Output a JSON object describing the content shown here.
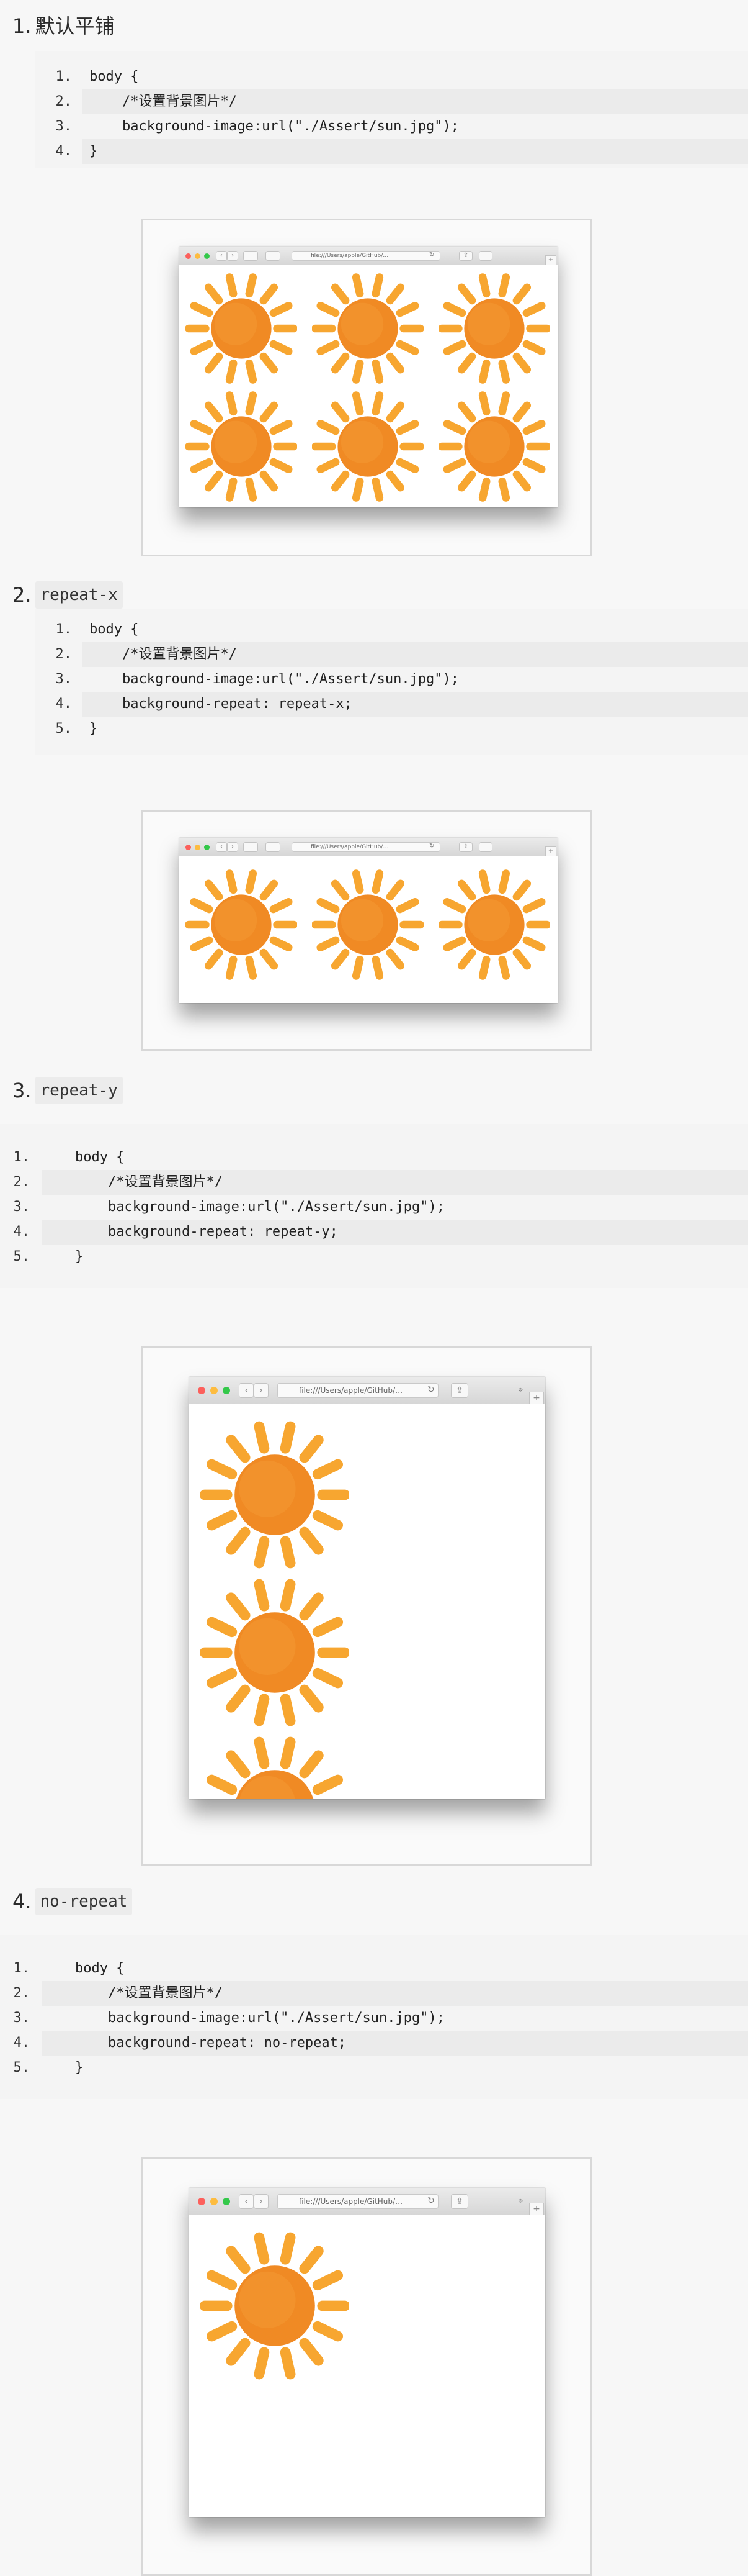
{
  "sections": [
    {
      "number": "1.",
      "title": "默认平铺",
      "lines": [
        {
          "n": "1.",
          "code": "body {"
        },
        {
          "n": "2.",
          "code": "    /*设置背景图片*/"
        },
        {
          "n": "3.",
          "code": "    background-image:url(\"./Assert/sun.jpg\");"
        },
        {
          "n": "4.",
          "code": "}"
        }
      ],
      "browser": {
        "url": "file:///Users/apple/GitHub/…"
      }
    },
    {
      "number": "2.",
      "title": "repeat-x",
      "lines": [
        {
          "n": "1.",
          "code": "body {"
        },
        {
          "n": "2.",
          "code": "    /*设置背景图片*/"
        },
        {
          "n": "3.",
          "code": "    background-image:url(\"./Assert/sun.jpg\");"
        },
        {
          "n": "4.",
          "code": "    background-repeat: repeat-x;"
        },
        {
          "n": "5.",
          "code": "}"
        }
      ],
      "browser": {
        "url": "file:///Users/apple/GitHub/…"
      }
    },
    {
      "number": "3.",
      "title": "repeat-y",
      "lines": [
        {
          "n": "1.",
          "code": "    body {"
        },
        {
          "n": "2.",
          "code": "        /*设置背景图片*/"
        },
        {
          "n": "3.",
          "code": "        background-image:url(\"./Assert/sun.jpg\");"
        },
        {
          "n": "4.",
          "code": "        background-repeat: repeat-y;"
        },
        {
          "n": "5.",
          "code": "    }"
        }
      ],
      "browser": {
        "url": "file:///Users/apple/GitHub/…"
      }
    },
    {
      "number": "4.",
      "title": "no-repeat",
      "lines": [
        {
          "n": "1.",
          "code": "    body {"
        },
        {
          "n": "2.",
          "code": "        /*设置背景图片*/"
        },
        {
          "n": "3.",
          "code": "        background-image:url(\"./Assert/sun.jpg\");"
        },
        {
          "n": "4.",
          "code": "        background-repeat: no-repeat;"
        },
        {
          "n": "5.",
          "code": "    }"
        }
      ],
      "browser": {
        "url": "file:///Users/apple/GitHub/…"
      }
    }
  ],
  "colors": {
    "sun_core": "#f08a24",
    "sun_ray": "#f7a630",
    "code_bg": "#f4f4f4",
    "stripe_bg": "#ebebeb"
  },
  "icons": [
    "sun-image",
    "close-dot",
    "minimize-dot",
    "zoom-dot",
    "back-icon",
    "forward-icon",
    "reload-icon",
    "share-icon",
    "new-tab-icon"
  ]
}
